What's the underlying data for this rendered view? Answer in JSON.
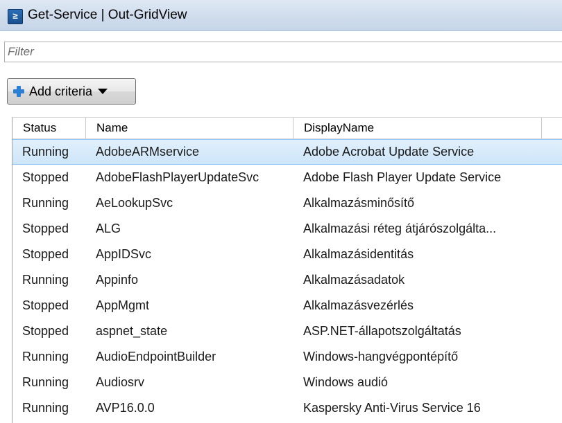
{
  "window": {
    "title": "Get-Service | Out-GridView",
    "icon": "powershell-icon",
    "icon_glyph": "≥"
  },
  "filter": {
    "placeholder": "Filter",
    "value": ""
  },
  "toolbar": {
    "add_criteria_label": "Add criteria"
  },
  "grid": {
    "columns": [
      "Status",
      "Name",
      "DisplayName"
    ],
    "selected_row_index": 0,
    "rows": [
      {
        "status": "Running",
        "name": "AdobeARMservice",
        "display": "Adobe Acrobat Update Service"
      },
      {
        "status": "Stopped",
        "name": "AdobeFlashPlayerUpdateSvc",
        "display": "Adobe Flash Player Update Service"
      },
      {
        "status": "Running",
        "name": "AeLookupSvc",
        "display": "Alkalmazásminősítő"
      },
      {
        "status": "Stopped",
        "name": "ALG",
        "display": "Alkalmazási réteg átjárószolgálta..."
      },
      {
        "status": "Stopped",
        "name": "AppIDSvc",
        "display": "Alkalmazásidentitás"
      },
      {
        "status": "Running",
        "name": "Appinfo",
        "display": "Alkalmazásadatok"
      },
      {
        "status": "Stopped",
        "name": "AppMgmt",
        "display": "Alkalmazásvezérlés"
      },
      {
        "status": "Stopped",
        "name": "aspnet_state",
        "display": "ASP.NET-állapotszolgáltatás"
      },
      {
        "status": "Running",
        "name": "AudioEndpointBuilder",
        "display": "Windows-hangvégpontépítő"
      },
      {
        "status": "Running",
        "name": "Audiosrv",
        "display": "Windows audió"
      },
      {
        "status": "Running",
        "name": "AVP16.0.0",
        "display": "Kaspersky Anti-Virus Service 16"
      }
    ]
  },
  "colors": {
    "titlebar": "#cfdcec",
    "selection": "#cde6fa",
    "selection_border": "#96c7f2",
    "plus_icon": "#2d7fd3"
  }
}
